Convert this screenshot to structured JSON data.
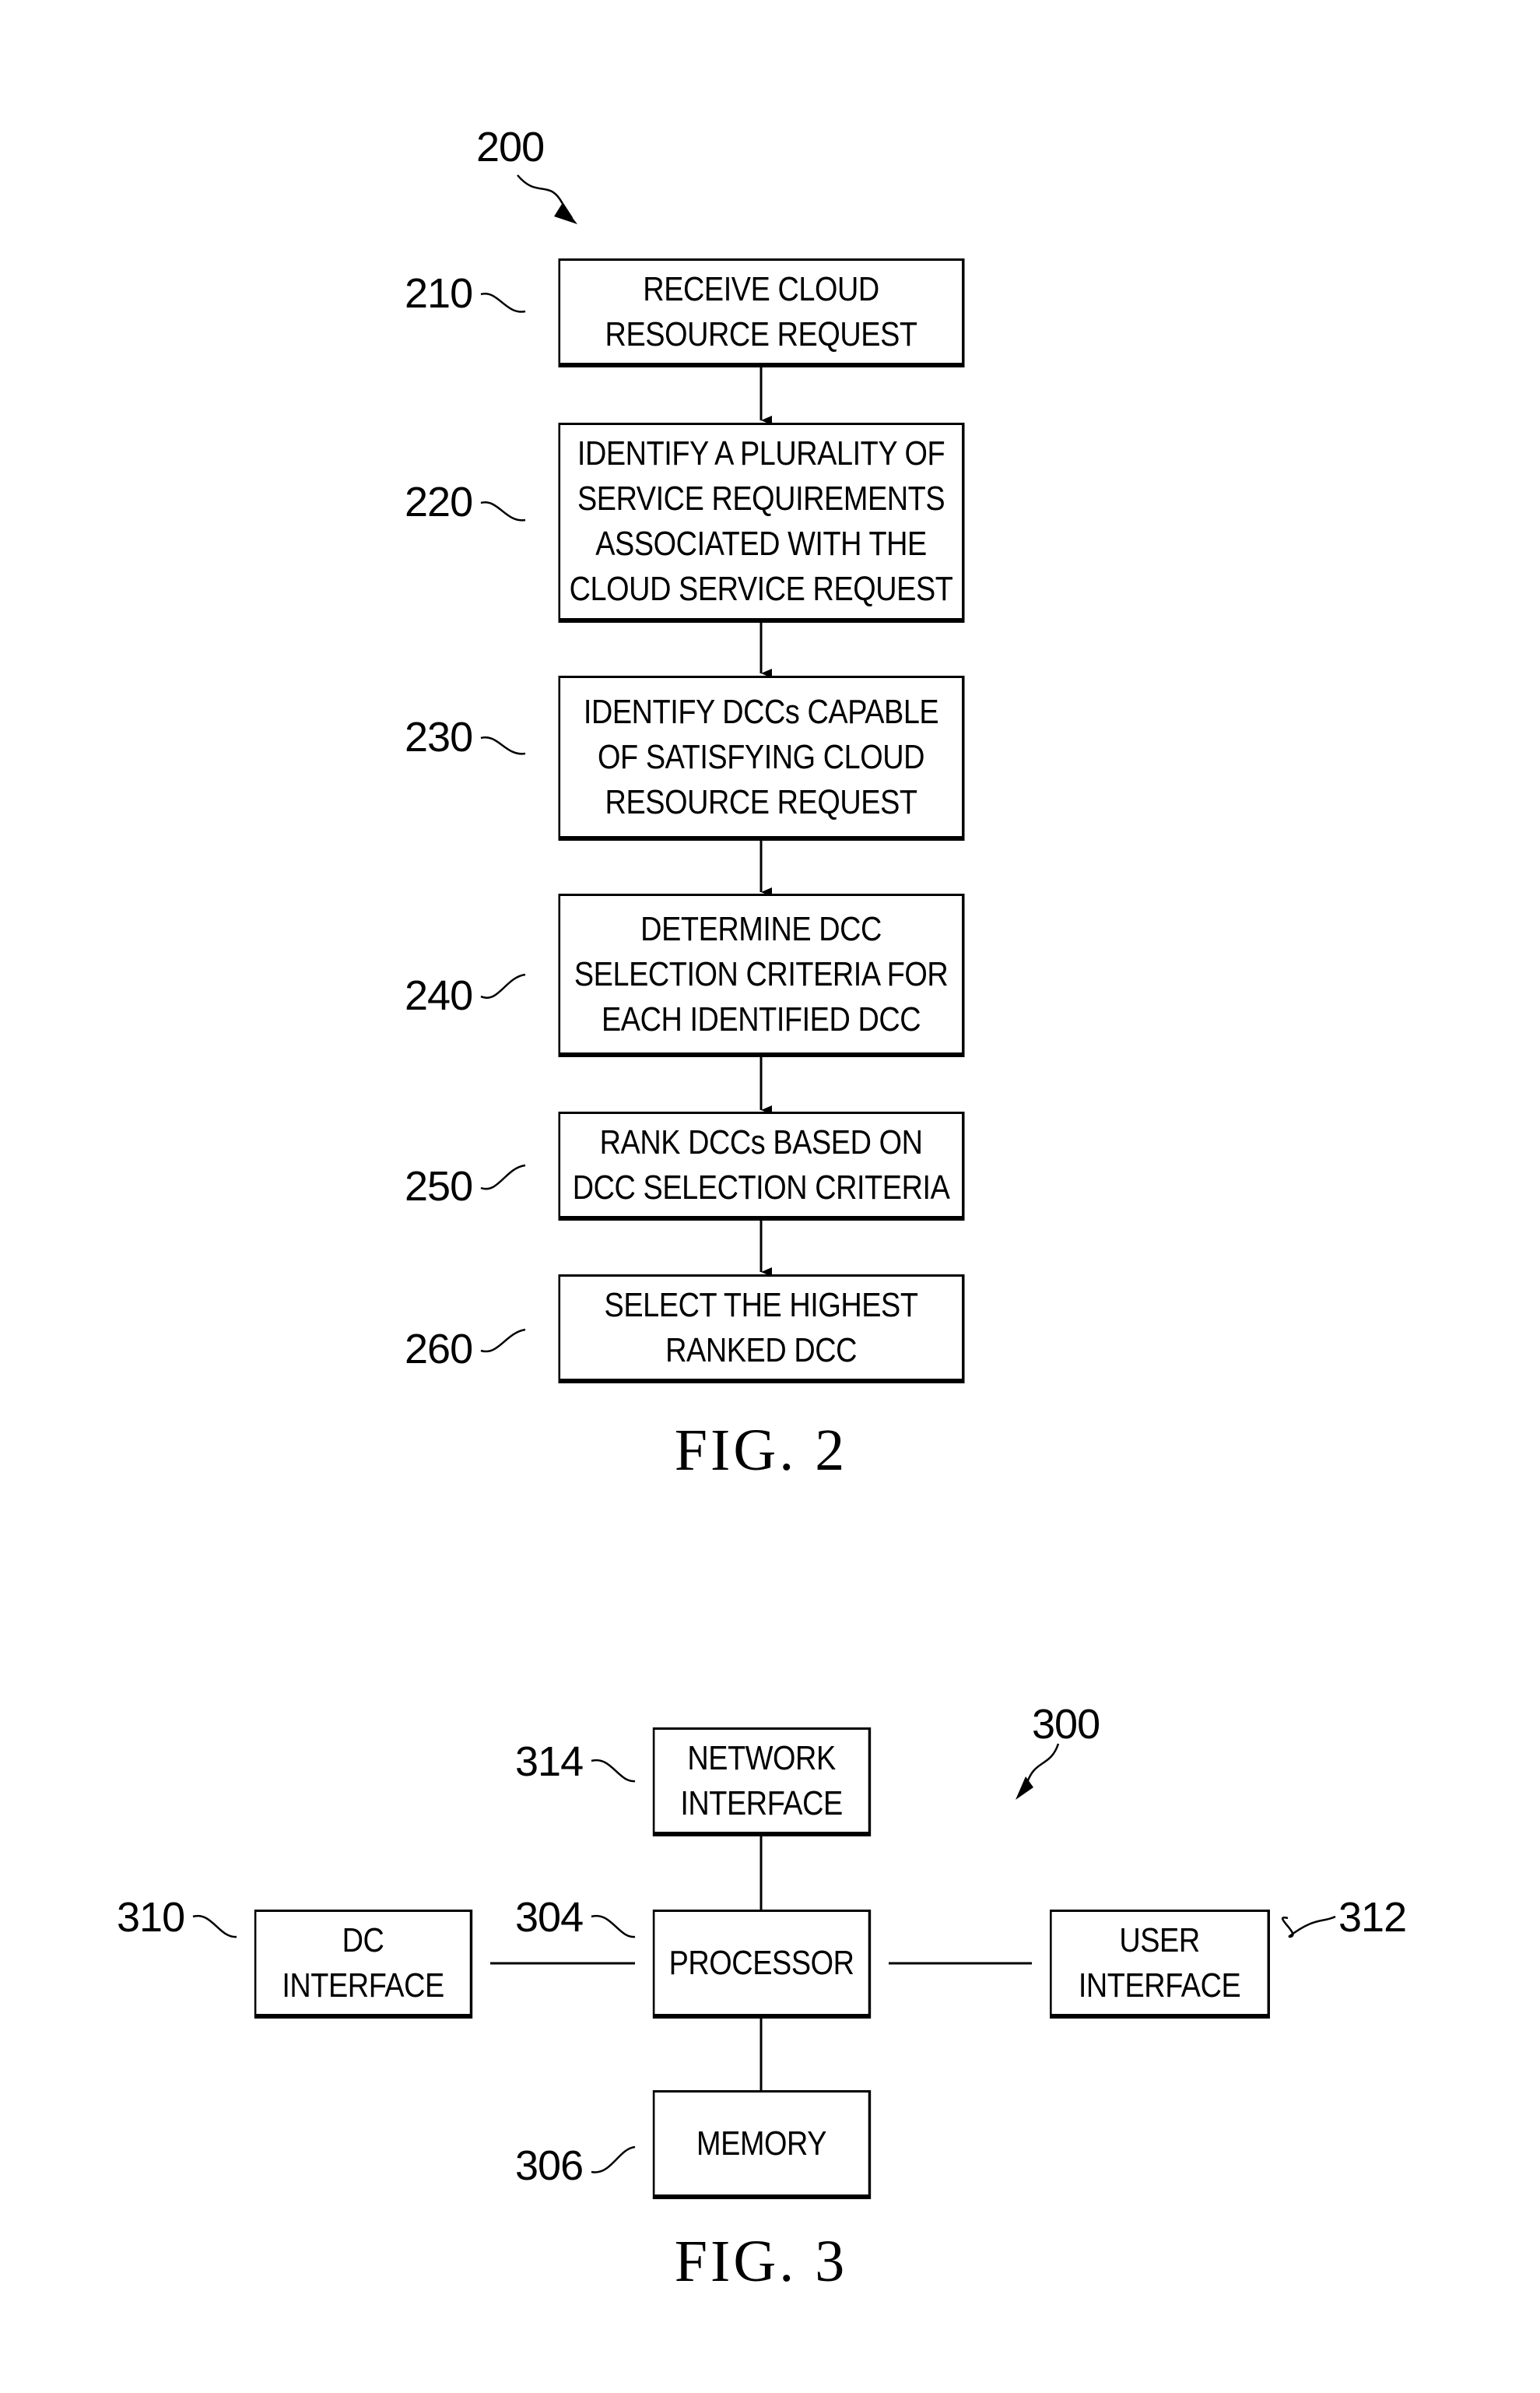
{
  "figure2": {
    "ref": "200",
    "caption": "FIG. 2",
    "steps": [
      {
        "ref": "210",
        "text": "RECEIVE CLOUD\nRESOURCE REQUEST"
      },
      {
        "ref": "220",
        "text": "IDENTIFY A PLURALITY OF\nSERVICE REQUIREMENTS\nASSOCIATED WITH THE\nCLOUD SERVICE REQUEST"
      },
      {
        "ref": "230",
        "text": "IDENTIFY DCCs CAPABLE\nOF SATISFYING CLOUD\nRESOURCE REQUEST"
      },
      {
        "ref": "240",
        "text": "DETERMINE DCC\nSELECTION CRITERIA FOR\nEACH IDENTIFIED DCC"
      },
      {
        "ref": "250",
        "text": "RANK DCCs BASED ON\nDCC SELECTION CRITERIA"
      },
      {
        "ref": "260",
        "text": "SELECT THE HIGHEST\nRANKED DCC"
      }
    ]
  },
  "figure3": {
    "ref": "300",
    "caption": "FIG. 3",
    "blocks": {
      "network_interface": {
        "ref": "314",
        "text": "NETWORK\nINTERFACE"
      },
      "processor": {
        "ref": "304",
        "text": "PROCESSOR"
      },
      "memory": {
        "ref": "306",
        "text": "MEMORY"
      },
      "dc_interface": {
        "ref": "310",
        "text": "DC\nINTERFACE"
      },
      "user_interface": {
        "ref": "312",
        "text": "USER\nINTERFACE"
      }
    }
  }
}
